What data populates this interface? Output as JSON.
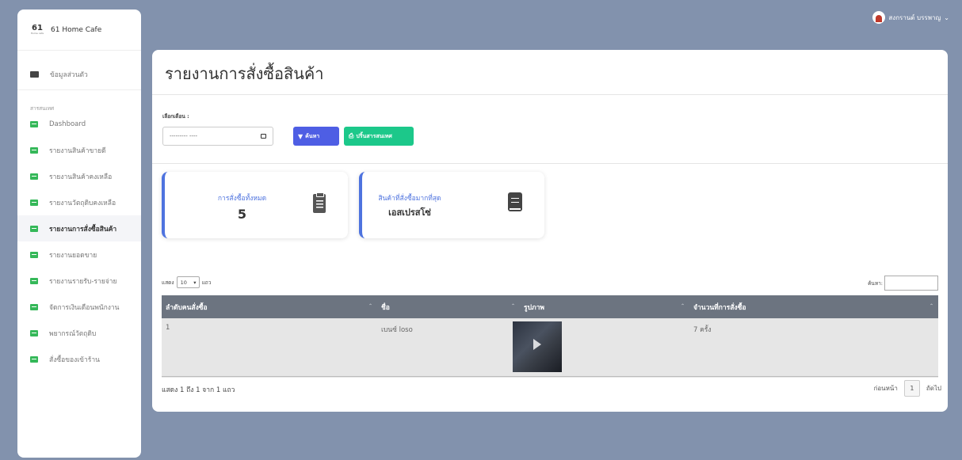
{
  "brand": {
    "logo_big": "61",
    "logo_small": "Home cafe",
    "name": "61 Home Cafe"
  },
  "user": {
    "name": "สงกรานต์ บรรพาญ"
  },
  "sidebar": {
    "profile": "ข้อมูลส่วนตัว",
    "section": "สารสนเทศ",
    "items": [
      {
        "label": "Dashboard",
        "active": false
      },
      {
        "label": "รายงานสินค้าขายดี",
        "active": false
      },
      {
        "label": "รายงานสินค้าคงเหลือ",
        "active": false
      },
      {
        "label": "รายงานวัตถุดิบคงเหลือ",
        "active": false
      },
      {
        "label": "รายงานการสั่งซื้อสินค้า",
        "active": true
      },
      {
        "label": "รายงานยอดขาย",
        "active": false
      },
      {
        "label": "รายงานรายรับ-รายจ่าย",
        "active": false
      },
      {
        "label": "จัดการเงินเดือนพนักงาน",
        "active": false
      },
      {
        "label": "พยากรณ์วัตถุดิบ",
        "active": false
      },
      {
        "label": "สั่งซื้อของเข้าร้าน",
        "active": false
      }
    ]
  },
  "page": {
    "title": "รายงานการสั่งซื้อสินค้า"
  },
  "filter": {
    "label": "เลือกเดือน :",
    "month_value": "--------- ----",
    "search_btn": "ค้นหา",
    "print_btn": "ปริ้นสารสนเทศ"
  },
  "stats": [
    {
      "label": "การสั่งซื้อทั้งหมด",
      "value": "5"
    },
    {
      "label": "สินค้าที่สั่งซื้อมากที่สุด",
      "value": "เอสเปรสโซ่"
    }
  ],
  "table_controls": {
    "show_prefix": "แสดง",
    "show_value": "10",
    "show_suffix": "แถว",
    "search_label": "ค้นหา:"
  },
  "table": {
    "headers": [
      "ลำดับคนสั่งซื้อ",
      "ชื่อ",
      "รูปภาพ",
      "จำนวนที่การสั่งซื้อ"
    ],
    "rows": [
      {
        "no": "1",
        "name": "เบนซ์ loso",
        "count": "7 ครั้ง"
      }
    ]
  },
  "footer": {
    "info": "แสดง 1 ถึง 1 จาก 1 แถว",
    "prev": "ก่อนหน้า",
    "page": "1",
    "next": "ถัดไป"
  }
}
